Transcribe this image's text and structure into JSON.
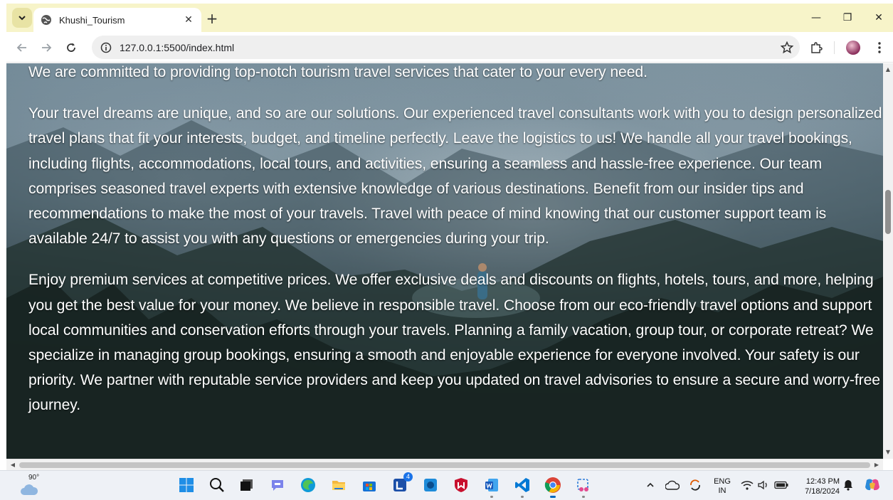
{
  "browser": {
    "tab": {
      "title": "Khushi_Tourism",
      "close_glyph": "✕"
    },
    "new_tab_glyph": "+",
    "url": "127.0.0.1:5500/index.html",
    "window_controls": {
      "minimize": "—",
      "restore": "❐",
      "close": "✕"
    }
  },
  "page": {
    "paragraphs": [
      "We are committed to providing top-notch tourism travel services that cater to your every need.",
      "Your travel dreams are unique, and so are our solutions. Our experienced travel consultants work with you to design personalized travel plans that fit your interests, budget, and timeline perfectly. Leave the logistics to us! We handle all your travel bookings, including flights, accommodations, local tours, and activities, ensuring a seamless and hassle-free experience. Our team comprises seasoned travel experts with extensive knowledge of various destinations. Benefit from our insider tips and recommendations to make the most of your travels. Travel with peace of mind knowing that our customer support team is available 24/7 to assist you with any questions or emergencies during your trip.",
      "Enjoy premium services at competitive prices. We offer exclusive deals and discounts on flights, hotels, tours, and more, helping you get the best value for your money. We believe in responsible travel. Choose from our eco-friendly travel options and support local communities and conservation efforts through your travels. Planning a family vacation, group tour, or corporate retreat? We specialize in managing group bookings, ensuring a smooth and enjoyable experience for everyone involved. Your safety is our priority. We partner with reputable service providers and keep you updated on travel advisories to ensure a secure and worry-free journey."
    ]
  },
  "taskbar": {
    "weather_temp": "90°",
    "apps": [
      "start-icon",
      "search-icon",
      "task-view-icon",
      "teams-icon",
      "edge-icon",
      "file-explorer-icon",
      "store-icon",
      "lens-icon",
      "app-icon",
      "mcafee-icon",
      "word-icon",
      "vscode-icon",
      "chrome-icon",
      "snipping-tool-icon"
    ],
    "app_badge": "4",
    "language": {
      "line1": "ENG",
      "line2": "IN"
    },
    "clock": {
      "time": "12:43 PM",
      "date": "7/18/2024"
    }
  },
  "colors": {
    "accent": "#0067c0",
    "titlebar": "#f7f4c9",
    "taskbar": "#eef1f6"
  }
}
